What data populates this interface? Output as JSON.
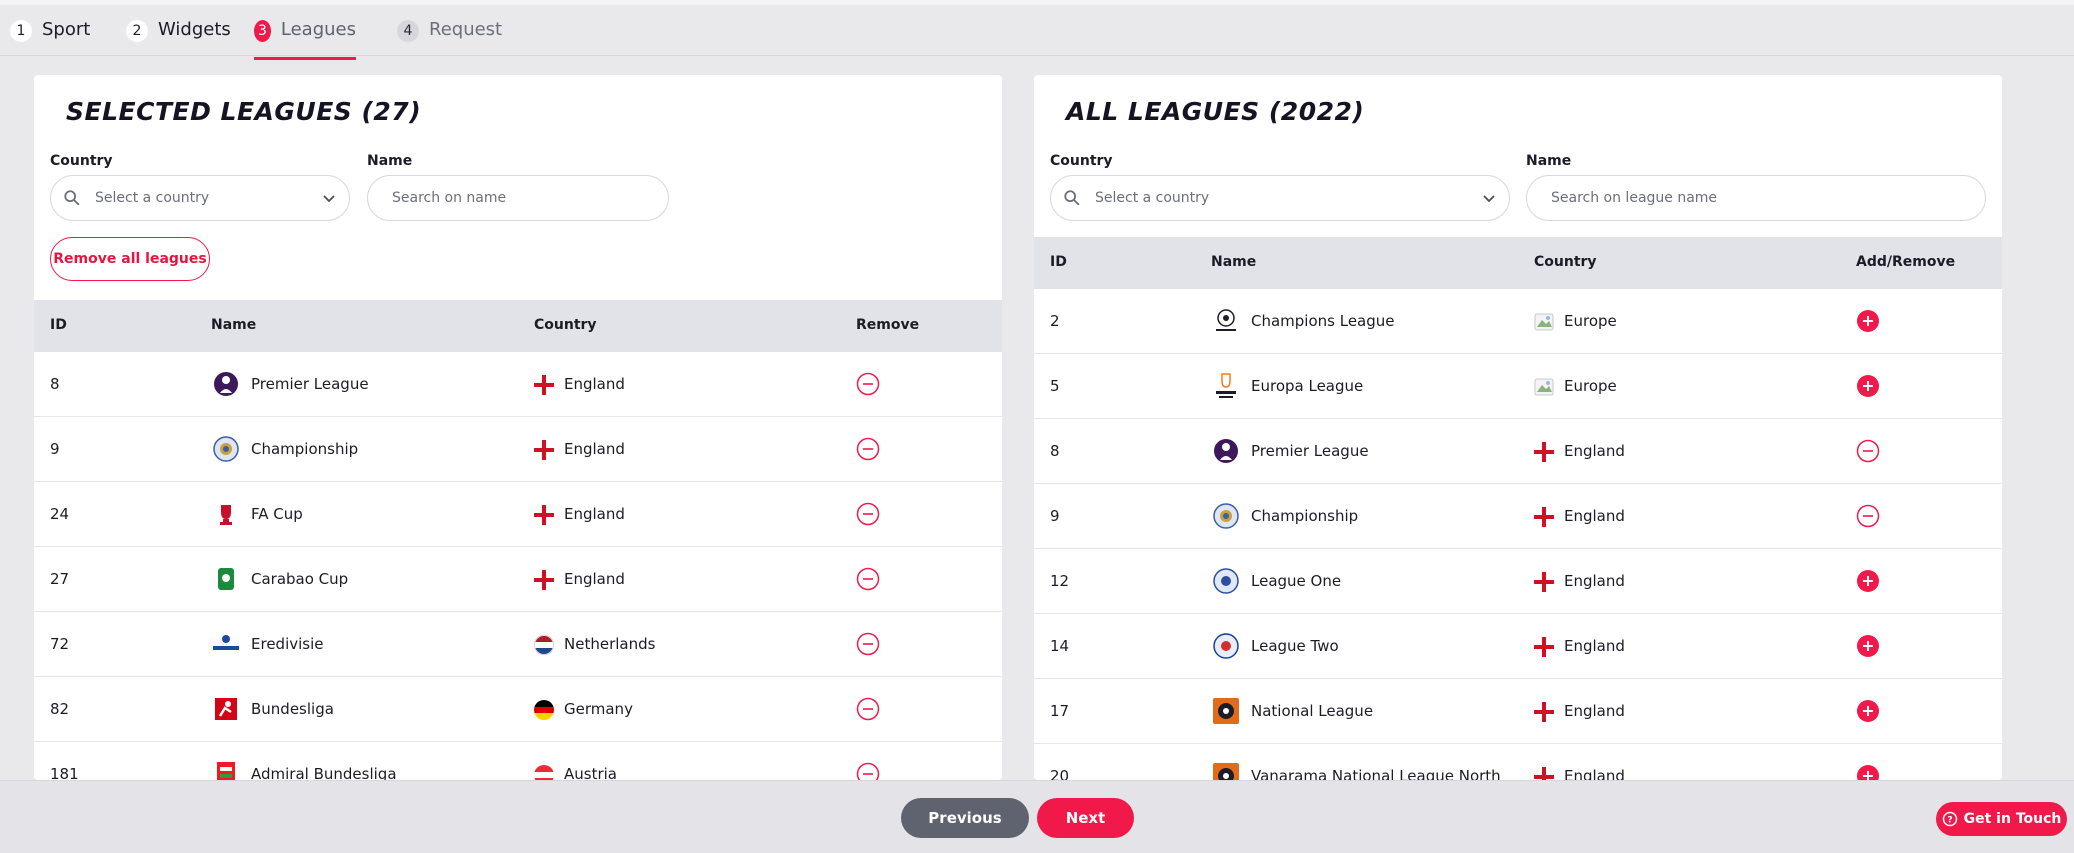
{
  "colors": {
    "accent": "#f0194a",
    "header_bg": "#e2e3e8",
    "prev_btn": "#5f636f"
  },
  "tabs": [
    {
      "num": "1",
      "label": "Sport"
    },
    {
      "num": "2",
      "label": "Widgets"
    },
    {
      "num": "3",
      "label": "Leagues"
    },
    {
      "num": "4",
      "label": "Request"
    }
  ],
  "selected": {
    "title": "SELECTED LEAGUES (27)",
    "country_label": "Country",
    "country_placeholder": "Select a country",
    "name_label": "Name",
    "name_placeholder": "Search on name",
    "remove_all": "Remove all leagues",
    "headers": {
      "id": "ID",
      "name": "Name",
      "country": "Country",
      "action": "Remove"
    },
    "rows": [
      {
        "id": "8",
        "name": "Premier League",
        "country": "England",
        "logo": "premier-league-logo",
        "flag": "england-flag"
      },
      {
        "id": "9",
        "name": "Championship",
        "country": "England",
        "logo": "championship-logo",
        "flag": "england-flag"
      },
      {
        "id": "24",
        "name": "FA Cup",
        "country": "England",
        "logo": "fa-cup-logo",
        "flag": "england-flag"
      },
      {
        "id": "27",
        "name": "Carabao Cup",
        "country": "England",
        "logo": "carabao-cup-logo",
        "flag": "england-flag"
      },
      {
        "id": "72",
        "name": "Eredivisie",
        "country": "Netherlands",
        "logo": "eredivisie-logo",
        "flag": "netherlands-flag"
      },
      {
        "id": "82",
        "name": "Bundesliga",
        "country": "Germany",
        "logo": "bundesliga-logo",
        "flag": "germany-flag"
      },
      {
        "id": "181",
        "name": "Admiral Bundesliga",
        "country": "Austria",
        "logo": "admiral-bundesliga-logo",
        "flag": "austria-flag"
      }
    ]
  },
  "all": {
    "title": "ALL LEAGUES (2022)",
    "country_label": "Country",
    "country_placeholder": "Select a country",
    "name_label": "Name",
    "name_placeholder": "Search on league name",
    "headers": {
      "id": "ID",
      "name": "Name",
      "country": "Country",
      "action": "Add/Remove"
    },
    "rows": [
      {
        "id": "2",
        "name": "Champions League",
        "country": "Europe",
        "state": "add",
        "logo": "champions-league-logo",
        "flag": "europe-flag"
      },
      {
        "id": "5",
        "name": "Europa League",
        "country": "Europe",
        "state": "add",
        "logo": "europa-league-logo",
        "flag": "europe-flag"
      },
      {
        "id": "8",
        "name": "Premier League",
        "country": "England",
        "state": "remove",
        "logo": "premier-league-logo",
        "flag": "england-flag"
      },
      {
        "id": "9",
        "name": "Championship",
        "country": "England",
        "state": "remove",
        "logo": "championship-logo",
        "flag": "england-flag"
      },
      {
        "id": "12",
        "name": "League One",
        "country": "England",
        "state": "add",
        "logo": "league-one-logo",
        "flag": "england-flag"
      },
      {
        "id": "14",
        "name": "League Two",
        "country": "England",
        "state": "add",
        "logo": "league-two-logo",
        "flag": "england-flag"
      },
      {
        "id": "17",
        "name": "National League",
        "country": "England",
        "state": "add",
        "logo": "national-league-logo",
        "flag": "england-flag"
      },
      {
        "id": "20",
        "name": "Vanarama National League North",
        "country": "England",
        "state": "add",
        "logo": "national-league-north-logo",
        "flag": "england-flag"
      }
    ]
  },
  "footer": {
    "previous": "Previous",
    "next": "Next",
    "get_in_touch": "Get in Touch"
  }
}
